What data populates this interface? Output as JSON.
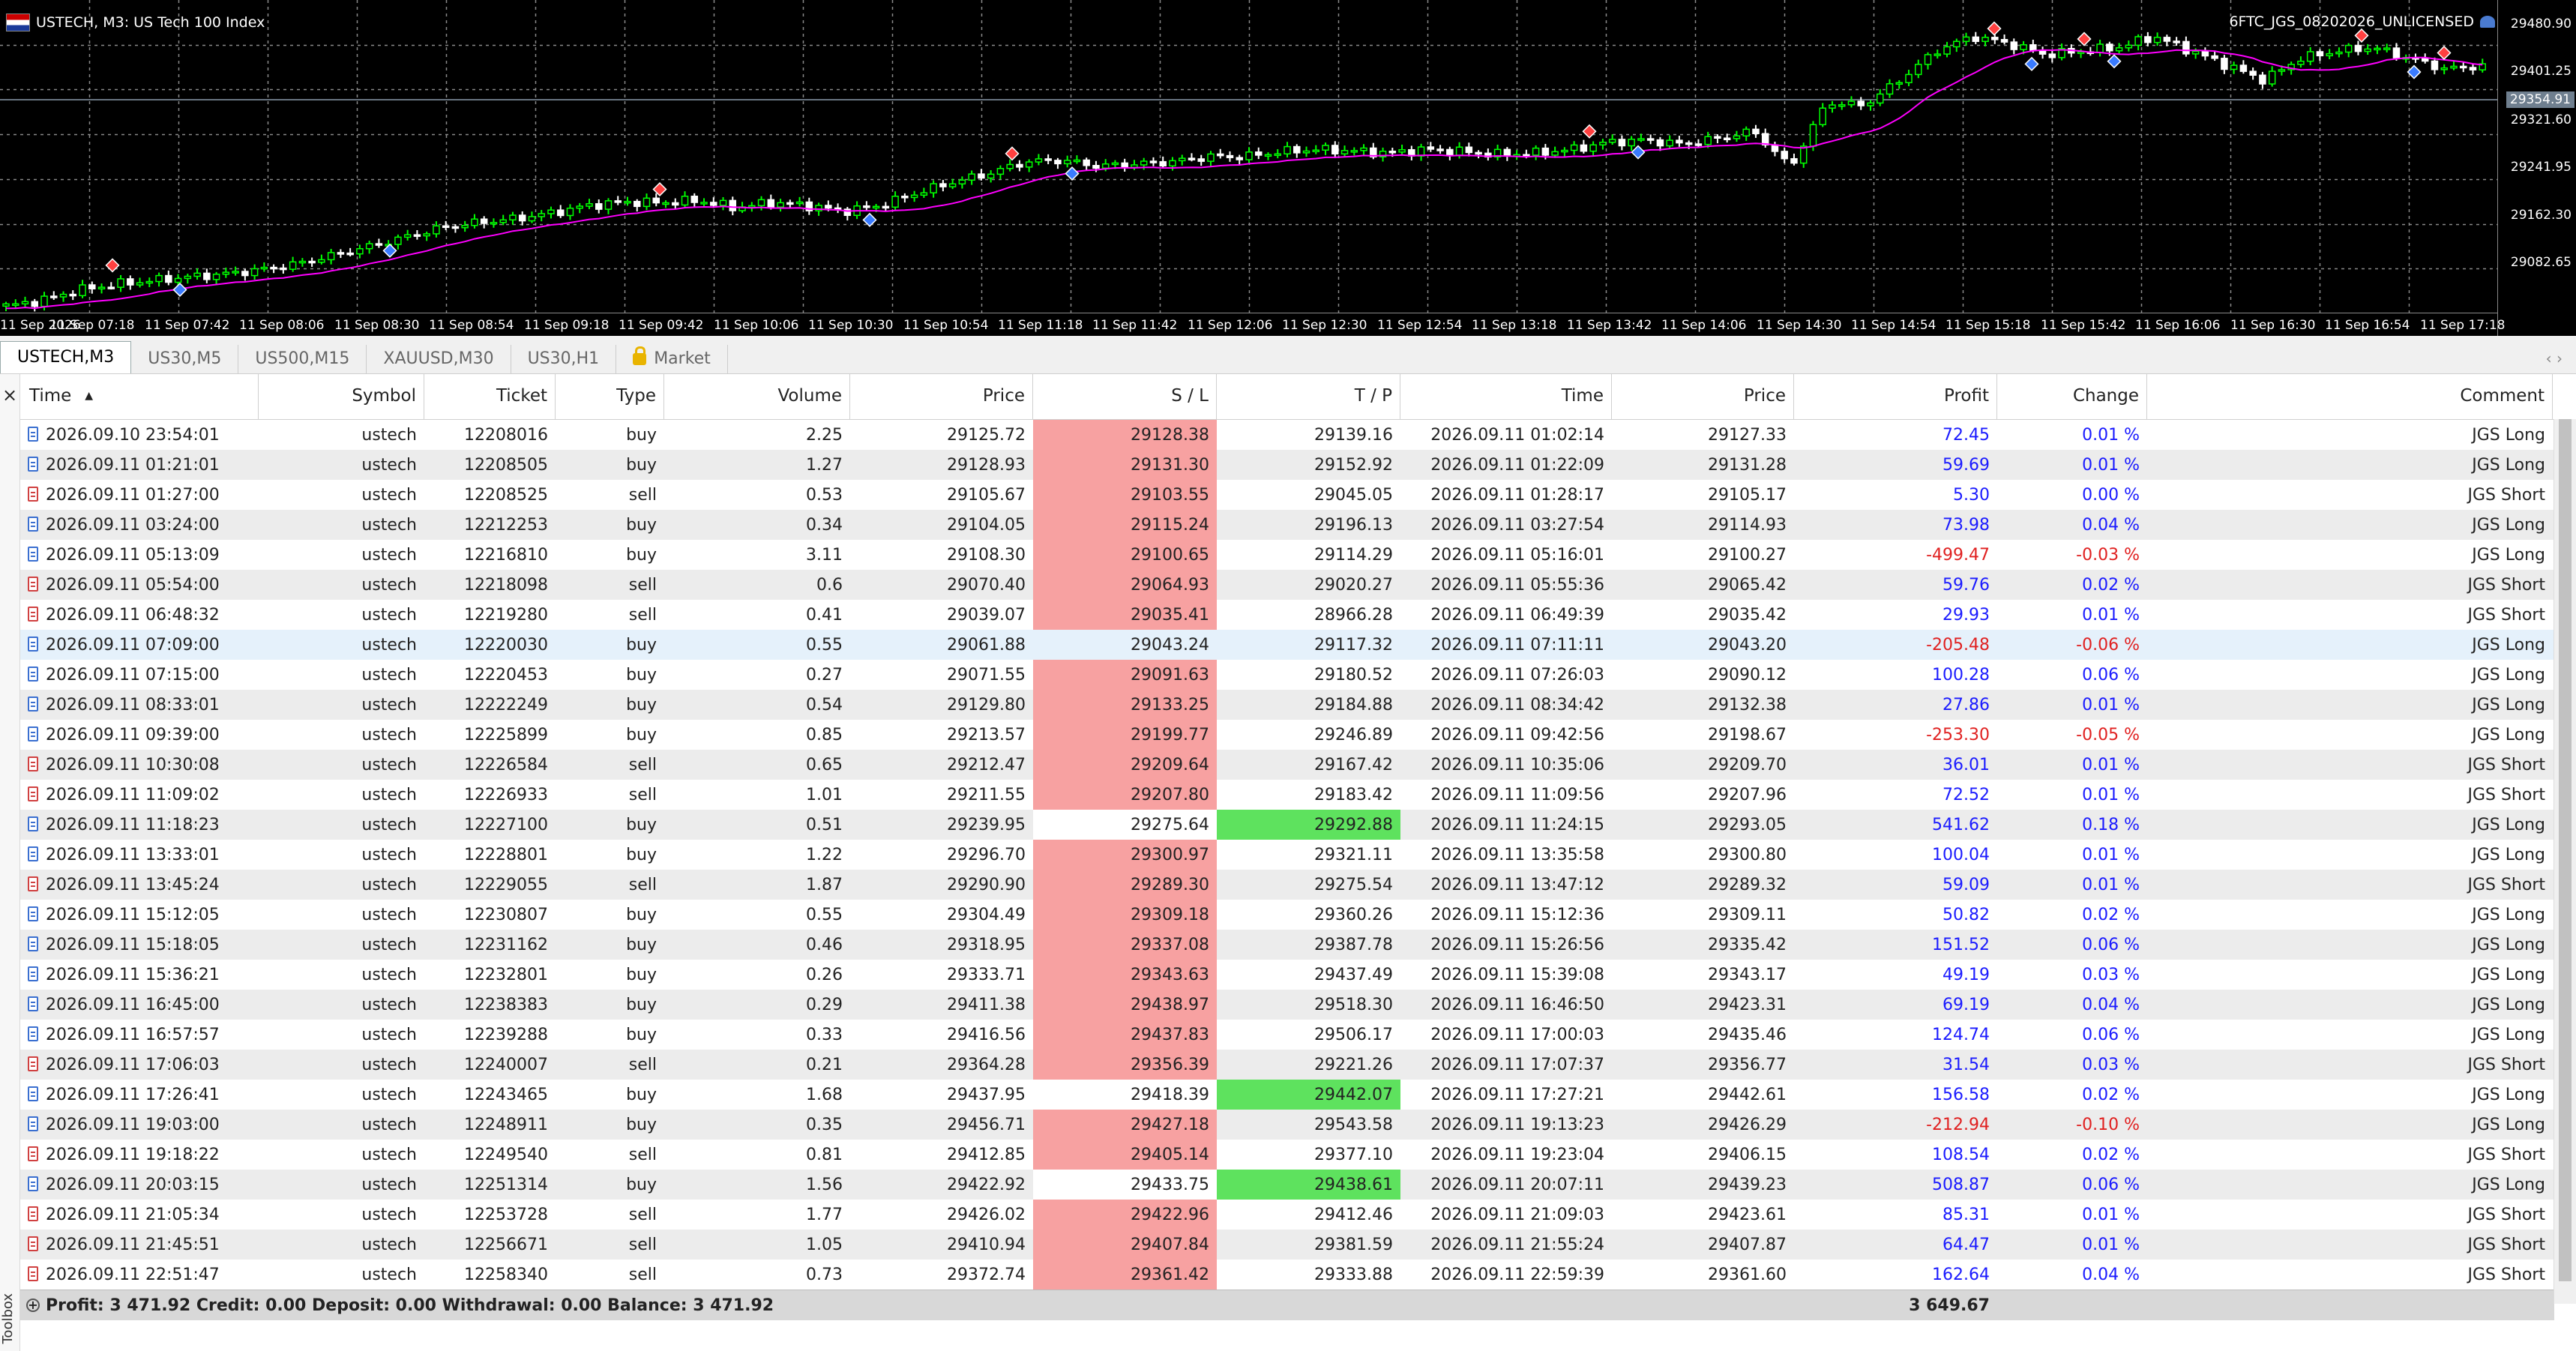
{
  "chart": {
    "title": "USTECH, M3:  US Tech 100 Index",
    "ea_label": "6FTC_JGS_08202026_UNLICENSED",
    "current_price": "29354.91",
    "price_labels": [
      "29480.90",
      "29401.25",
      "29321.60",
      "29241.95",
      "29162.30",
      "29082.65"
    ],
    "time_labels": [
      "11 Sep 2026",
      "11 Sep 07:18",
      "11 Sep 07:42",
      "11 Sep 08:06",
      "11 Sep 08:30",
      "11 Sep 08:54",
      "11 Sep 09:18",
      "11 Sep 09:42",
      "11 Sep 10:06",
      "11 Sep 10:30",
      "11 Sep 10:54",
      "11 Sep 11:18",
      "11 Sep 11:42",
      "11 Sep 12:06",
      "11 Sep 12:30",
      "11 Sep 12:54",
      "11 Sep 13:18",
      "11 Sep 13:42",
      "11 Sep 14:06",
      "11 Sep 14:30",
      "11 Sep 14:54",
      "11 Sep 15:18",
      "11 Sep 15:42",
      "11 Sep 16:06",
      "11 Sep 16:30",
      "11 Sep 16:54",
      "11 Sep 17:18"
    ],
    "price_path": [
      29070,
      29078,
      29092,
      29100,
      29105,
      29110,
      29114,
      29120,
      29128,
      29140,
      29152,
      29165,
      29178,
      29185,
      29190,
      29198,
      29208,
      29213,
      29212,
      29215,
      29205,
      29212,
      29208,
      29200,
      29208,
      29225,
      29240,
      29252,
      29268,
      29270,
      29262,
      29265,
      29268,
      29275,
      29275,
      29282,
      29285,
      29283,
      29280,
      29285,
      29282,
      29278,
      29280,
      29285,
      29295,
      29298,
      29292,
      29300,
      29310,
      29260,
      29350,
      29345,
      29380,
      29420,
      29440,
      29430,
      29415,
      29420,
      29425,
      29440,
      29420,
      29400,
      29380,
      29410,
      29420,
      29425,
      29410,
      29395,
      29400
    ],
    "colors": {
      "bull": "#00ff00",
      "bear": "#ffffff",
      "ma": "#ff00ff",
      "grid": "#8a8a8a"
    }
  },
  "tabs": [
    {
      "label": "USTECH,M3",
      "active": true
    },
    {
      "label": "US30,M5"
    },
    {
      "label": "US500,M15"
    },
    {
      "label": "XAUUSD,M30"
    },
    {
      "label": "US30,H1"
    },
    {
      "label": "Market",
      "lock": true
    }
  ],
  "columns": [
    "Time",
    "Symbol",
    "Ticket",
    "Type",
    "Volume",
    "Price",
    "S / L",
    "T / P",
    "Time",
    "Price",
    "Profit",
    "Change",
    "Comment"
  ],
  "rows": [
    {
      "time": "2026.09.10 23:54:01",
      "symbol": "ustech",
      "ticket": "12208016",
      "type": "buy",
      "volume": "2.25",
      "price": "29125.72",
      "sl": "29128.38",
      "sl_hit": "red",
      "tp": "29139.16",
      "tp_hit": "",
      "ctime": "2026.09.11 01:02:14",
      "cprice": "29127.33",
      "profit": "72.45",
      "change": "0.01 %",
      "comment": "JGS Long"
    },
    {
      "time": "2026.09.11 01:21:01",
      "symbol": "ustech",
      "ticket": "12208505",
      "type": "buy",
      "volume": "1.27",
      "price": "29128.93",
      "sl": "29131.30",
      "sl_hit": "red",
      "tp": "29152.92",
      "tp_hit": "",
      "ctime": "2026.09.11 01:22:09",
      "cprice": "29131.28",
      "profit": "59.69",
      "change": "0.01 %",
      "comment": "JGS Long"
    },
    {
      "time": "2026.09.11 01:27:00",
      "symbol": "ustech",
      "ticket": "12208525",
      "type": "sell",
      "volume": "0.53",
      "price": "29105.67",
      "sl": "29103.55",
      "sl_hit": "red",
      "tp": "29045.05",
      "tp_hit": "",
      "ctime": "2026.09.11 01:28:17",
      "cprice": "29105.17",
      "profit": "5.30",
      "change": "0.00 %",
      "comment": "JGS Short"
    },
    {
      "time": "2026.09.11 03:24:00",
      "symbol": "ustech",
      "ticket": "12212253",
      "type": "buy",
      "volume": "0.34",
      "price": "29104.05",
      "sl": "29115.24",
      "sl_hit": "red",
      "tp": "29196.13",
      "tp_hit": "",
      "ctime": "2026.09.11 03:27:54",
      "cprice": "29114.93",
      "profit": "73.98",
      "change": "0.04 %",
      "comment": "JGS Long"
    },
    {
      "time": "2026.09.11 05:13:09",
      "symbol": "ustech",
      "ticket": "12216810",
      "type": "buy",
      "volume": "3.11",
      "price": "29108.30",
      "sl": "29100.65",
      "sl_hit": "red",
      "tp": "29114.29",
      "tp_hit": "",
      "ctime": "2026.09.11 05:16:01",
      "cprice": "29100.27",
      "profit": "-499.47",
      "change": "-0.03 %",
      "comment": "JGS Long"
    },
    {
      "time": "2026.09.11 05:54:00",
      "symbol": "ustech",
      "ticket": "12218098",
      "type": "sell",
      "volume": "0.6",
      "price": "29070.40",
      "sl": "29064.93",
      "sl_hit": "red",
      "tp": "29020.27",
      "tp_hit": "",
      "ctime": "2026.09.11 05:55:36",
      "cprice": "29065.42",
      "profit": "59.76",
      "change": "0.02 %",
      "comment": "JGS Short"
    },
    {
      "time": "2026.09.11 06:48:32",
      "symbol": "ustech",
      "ticket": "12219280",
      "type": "sell",
      "volume": "0.41",
      "price": "29039.07",
      "sl": "29035.41",
      "sl_hit": "red",
      "tp": "28966.28",
      "tp_hit": "",
      "ctime": "2026.09.11 06:49:39",
      "cprice": "29035.42",
      "profit": "29.93",
      "change": "0.01 %",
      "comment": "JGS Short"
    },
    {
      "time": "2026.09.11 07:09:00",
      "symbol": "ustech",
      "ticket": "12220030",
      "type": "buy",
      "volume": "0.55",
      "price": "29061.88",
      "sl": "29043.24",
      "sl_hit": "",
      "tp": "29117.32",
      "tp_hit": "",
      "ctime": "2026.09.11 07:11:11",
      "cprice": "29043.20",
      "profit": "-205.48",
      "change": "-0.06 %",
      "comment": "JGS Long",
      "selected": true
    },
    {
      "time": "2026.09.11 07:15:00",
      "symbol": "ustech",
      "ticket": "12220453",
      "type": "buy",
      "volume": "0.27",
      "price": "29071.55",
      "sl": "29091.63",
      "sl_hit": "red",
      "tp": "29180.52",
      "tp_hit": "",
      "ctime": "2026.09.11 07:26:03",
      "cprice": "29090.12",
      "profit": "100.28",
      "change": "0.06 %",
      "comment": "JGS Long"
    },
    {
      "time": "2026.09.11 08:33:01",
      "symbol": "ustech",
      "ticket": "12222249",
      "type": "buy",
      "volume": "0.54",
      "price": "29129.80",
      "sl": "29133.25",
      "sl_hit": "red",
      "tp": "29184.88",
      "tp_hit": "",
      "ctime": "2026.09.11 08:34:42",
      "cprice": "29132.38",
      "profit": "27.86",
      "change": "0.01 %",
      "comment": "JGS Long"
    },
    {
      "time": "2026.09.11 09:39:00",
      "symbol": "ustech",
      "ticket": "12225899",
      "type": "buy",
      "volume": "0.85",
      "price": "29213.57",
      "sl": "29199.77",
      "sl_hit": "red",
      "tp": "29246.89",
      "tp_hit": "",
      "ctime": "2026.09.11 09:42:56",
      "cprice": "29198.67",
      "profit": "-253.30",
      "change": "-0.05 %",
      "comment": "JGS Long"
    },
    {
      "time": "2026.09.11 10:30:08",
      "symbol": "ustech",
      "ticket": "12226584",
      "type": "sell",
      "volume": "0.65",
      "price": "29212.47",
      "sl": "29209.64",
      "sl_hit": "red",
      "tp": "29167.42",
      "tp_hit": "",
      "ctime": "2026.09.11 10:35:06",
      "cprice": "29209.70",
      "profit": "36.01",
      "change": "0.01 %",
      "comment": "JGS Short"
    },
    {
      "time": "2026.09.11 11:09:02",
      "symbol": "ustech",
      "ticket": "12226933",
      "type": "sell",
      "volume": "1.01",
      "price": "29211.55",
      "sl": "29207.80",
      "sl_hit": "red",
      "tp": "29183.42",
      "tp_hit": "",
      "ctime": "2026.09.11 11:09:56",
      "cprice": "29207.96",
      "profit": "72.52",
      "change": "0.01 %",
      "comment": "JGS Short"
    },
    {
      "time": "2026.09.11 11:18:23",
      "symbol": "ustech",
      "ticket": "12227100",
      "type": "buy",
      "volume": "0.51",
      "price": "29239.95",
      "sl": "29275.64",
      "sl_hit": "white",
      "tp": "29292.88",
      "tp_hit": "green",
      "ctime": "2026.09.11 11:24:15",
      "cprice": "29293.05",
      "profit": "541.62",
      "change": "0.18 %",
      "comment": "JGS Long"
    },
    {
      "time": "2026.09.11 13:33:01",
      "symbol": "ustech",
      "ticket": "12228801",
      "type": "buy",
      "volume": "1.22",
      "price": "29296.70",
      "sl": "29300.97",
      "sl_hit": "red",
      "tp": "29321.11",
      "tp_hit": "",
      "ctime": "2026.09.11 13:35:58",
      "cprice": "29300.80",
      "profit": "100.04",
      "change": "0.01 %",
      "comment": "JGS Long"
    },
    {
      "time": "2026.09.11 13:45:24",
      "symbol": "ustech",
      "ticket": "12229055",
      "type": "sell",
      "volume": "1.87",
      "price": "29290.90",
      "sl": "29289.30",
      "sl_hit": "red",
      "tp": "29275.54",
      "tp_hit": "",
      "ctime": "2026.09.11 13:47:12",
      "cprice": "29289.32",
      "profit": "59.09",
      "change": "0.01 %",
      "comment": "JGS Short"
    },
    {
      "time": "2026.09.11 15:12:05",
      "symbol": "ustech",
      "ticket": "12230807",
      "type": "buy",
      "volume": "0.55",
      "price": "29304.49",
      "sl": "29309.18",
      "sl_hit": "red",
      "tp": "29360.26",
      "tp_hit": "",
      "ctime": "2026.09.11 15:12:36",
      "cprice": "29309.11",
      "profit": "50.82",
      "change": "0.02 %",
      "comment": "JGS Long"
    },
    {
      "time": "2026.09.11 15:18:05",
      "symbol": "ustech",
      "ticket": "12231162",
      "type": "buy",
      "volume": "0.46",
      "price": "29318.95",
      "sl": "29337.08",
      "sl_hit": "red",
      "tp": "29387.78",
      "tp_hit": "",
      "ctime": "2026.09.11 15:26:56",
      "cprice": "29335.42",
      "profit": "151.52",
      "change": "0.06 %",
      "comment": "JGS Long"
    },
    {
      "time": "2026.09.11 15:36:21",
      "symbol": "ustech",
      "ticket": "12232801",
      "type": "buy",
      "volume": "0.26",
      "price": "29333.71",
      "sl": "29343.63",
      "sl_hit": "red",
      "tp": "29437.49",
      "tp_hit": "",
      "ctime": "2026.09.11 15:39:08",
      "cprice": "29343.17",
      "profit": "49.19",
      "change": "0.03 %",
      "comment": "JGS Long"
    },
    {
      "time": "2026.09.11 16:45:00",
      "symbol": "ustech",
      "ticket": "12238383",
      "type": "buy",
      "volume": "0.29",
      "price": "29411.38",
      "sl": "29438.97",
      "sl_hit": "red",
      "tp": "29518.30",
      "tp_hit": "",
      "ctime": "2026.09.11 16:46:50",
      "cprice": "29423.31",
      "profit": "69.19",
      "change": "0.04 %",
      "comment": "JGS Long"
    },
    {
      "time": "2026.09.11 16:57:57",
      "symbol": "ustech",
      "ticket": "12239288",
      "type": "buy",
      "volume": "0.33",
      "price": "29416.56",
      "sl": "29437.83",
      "sl_hit": "red",
      "tp": "29506.17",
      "tp_hit": "",
      "ctime": "2026.09.11 17:00:03",
      "cprice": "29435.46",
      "profit": "124.74",
      "change": "0.06 %",
      "comment": "JGS Long"
    },
    {
      "time": "2026.09.11 17:06:03",
      "symbol": "ustech",
      "ticket": "12240007",
      "type": "sell",
      "volume": "0.21",
      "price": "29364.28",
      "sl": "29356.39",
      "sl_hit": "red",
      "tp": "29221.26",
      "tp_hit": "",
      "ctime": "2026.09.11 17:07:37",
      "cprice": "29356.77",
      "profit": "31.54",
      "change": "0.03 %",
      "comment": "JGS Short"
    },
    {
      "time": "2026.09.11 17:26:41",
      "symbol": "ustech",
      "ticket": "12243465",
      "type": "buy",
      "volume": "1.68",
      "price": "29437.95",
      "sl": "29418.39",
      "sl_hit": "",
      "tp": "29442.07",
      "tp_hit": "green",
      "ctime": "2026.09.11 17:27:21",
      "cprice": "29442.61",
      "profit": "156.58",
      "change": "0.02 %",
      "comment": "JGS Long"
    },
    {
      "time": "2026.09.11 19:03:00",
      "symbol": "ustech",
      "ticket": "12248911",
      "type": "buy",
      "volume": "0.35",
      "price": "29456.71",
      "sl": "29427.18",
      "sl_hit": "red",
      "tp": "29543.58",
      "tp_hit": "",
      "ctime": "2026.09.11 19:13:23",
      "cprice": "29426.29",
      "profit": "-212.94",
      "change": "-0.10 %",
      "comment": "JGS Long"
    },
    {
      "time": "2026.09.11 19:18:22",
      "symbol": "ustech",
      "ticket": "12249540",
      "type": "sell",
      "volume": "0.81",
      "price": "29412.85",
      "sl": "29405.14",
      "sl_hit": "red",
      "tp": "29377.10",
      "tp_hit": "",
      "ctime": "2026.09.11 19:23:04",
      "cprice": "29406.15",
      "profit": "108.54",
      "change": "0.02 %",
      "comment": "JGS Short"
    },
    {
      "time": "2026.09.11 20:03:15",
      "symbol": "ustech",
      "ticket": "12251314",
      "type": "buy",
      "volume": "1.56",
      "price": "29422.92",
      "sl": "29433.75",
      "sl_hit": "white",
      "tp": "29438.61",
      "tp_hit": "green",
      "ctime": "2026.09.11 20:07:11",
      "cprice": "29439.23",
      "profit": "508.87",
      "change": "0.06 %",
      "comment": "JGS Long"
    },
    {
      "time": "2026.09.11 21:05:34",
      "symbol": "ustech",
      "ticket": "12253728",
      "type": "sell",
      "volume": "1.77",
      "price": "29426.02",
      "sl": "29422.96",
      "sl_hit": "red",
      "tp": "29412.46",
      "tp_hit": "",
      "ctime": "2026.09.11 21:09:03",
      "cprice": "29423.61",
      "profit": "85.31",
      "change": "0.01 %",
      "comment": "JGS Short"
    },
    {
      "time": "2026.09.11 21:45:51",
      "symbol": "ustech",
      "ticket": "12256671",
      "type": "sell",
      "volume": "1.05",
      "price": "29410.94",
      "sl": "29407.84",
      "sl_hit": "red",
      "tp": "29381.59",
      "tp_hit": "",
      "ctime": "2026.09.11 21:55:24",
      "cprice": "29407.87",
      "profit": "64.47",
      "change": "0.01 %",
      "comment": "JGS Short"
    },
    {
      "time": "2026.09.11 22:51:47",
      "symbol": "ustech",
      "ticket": "12258340",
      "type": "sell",
      "volume": "0.73",
      "price": "29372.74",
      "sl": "29361.42",
      "sl_hit": "red",
      "tp": "29333.88",
      "tp_hit": "",
      "ctime": "2026.09.11 22:59:39",
      "cprice": "29361.60",
      "profit": "162.64",
      "change": "0.04 %",
      "comment": "JGS Short"
    }
  ],
  "summary": {
    "text": "Profit: 3 471.92  Credit: 0.00  Deposit: 0.00  Withdrawal: 0.00  Balance: 3 471.92",
    "total_profit": "3 649.67"
  },
  "toolbox_label": "Toolbox"
}
